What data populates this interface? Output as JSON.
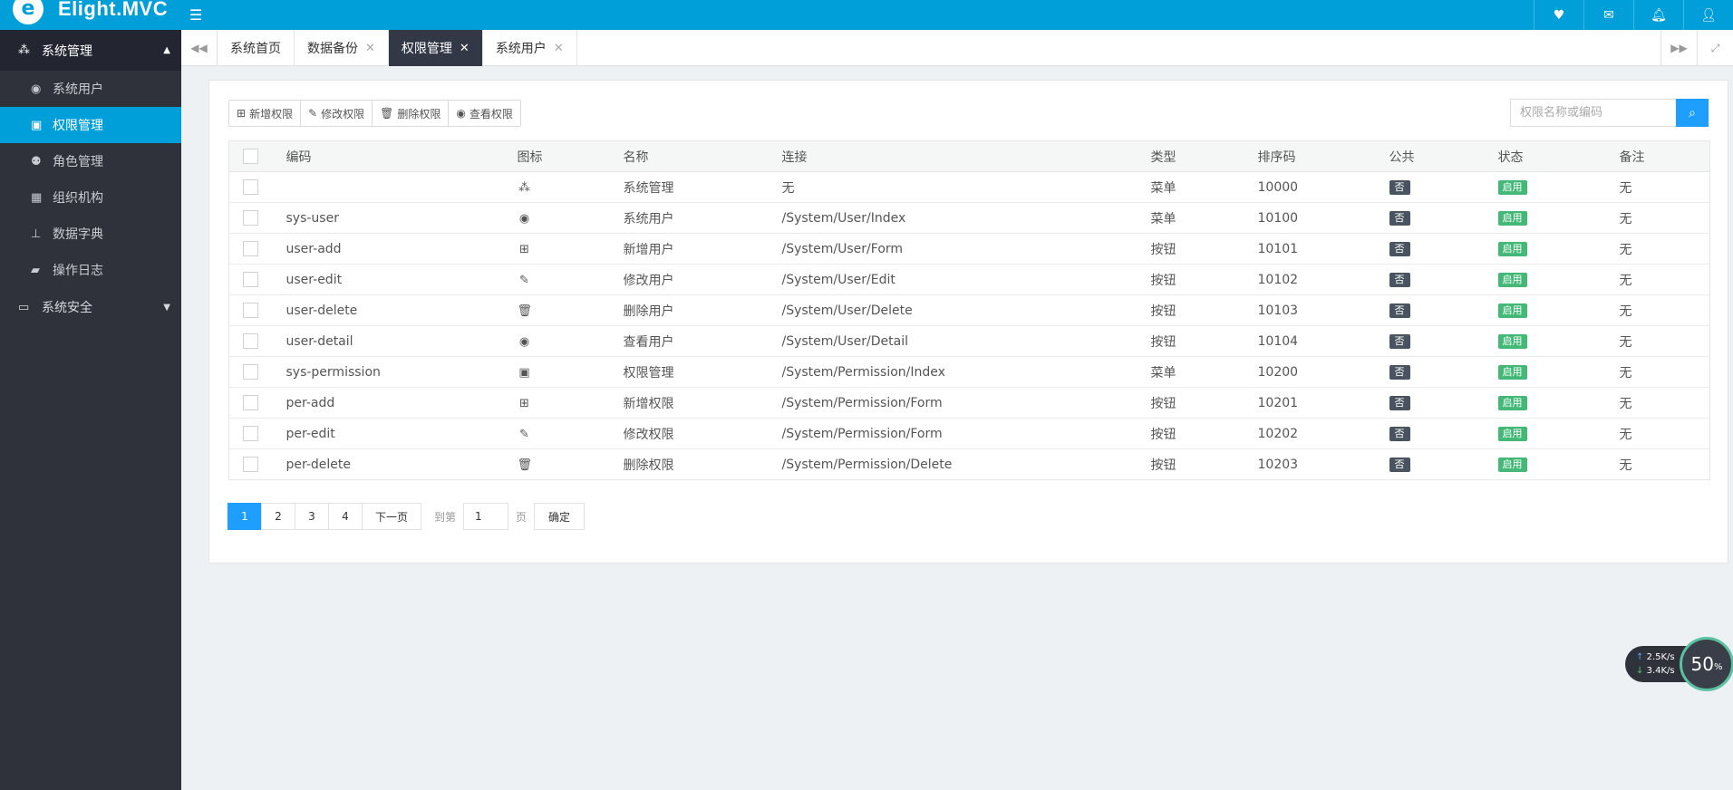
{
  "header": {
    "logo_mark": "e",
    "app_title": "Elight.MVC",
    "menu_icon": "list-icon",
    "icons": [
      "heart-icon",
      "mail-icon",
      "bell-icon",
      "user-icon"
    ]
  },
  "sidebar": {
    "group1": {
      "label": "系统管理",
      "icon": "cubes-icon"
    },
    "items": [
      {
        "label": "系统用户",
        "icon": "user-circle-icon",
        "active": false
      },
      {
        "label": "权限管理",
        "icon": "briefcase-icon",
        "active": true
      },
      {
        "label": "角色管理",
        "icon": "users-icon",
        "active": false
      },
      {
        "label": "组织机构",
        "icon": "building-icon",
        "active": false
      },
      {
        "label": "数据字典",
        "icon": "sitemap-icon",
        "active": false
      },
      {
        "label": "操作日志",
        "icon": "folder-open-icon",
        "active": false
      }
    ],
    "group2": {
      "label": "系统安全",
      "icon": "desktop-icon"
    }
  },
  "tabs": [
    {
      "label": "系统首页",
      "closable": false,
      "active": false
    },
    {
      "label": "数据备份",
      "closable": true,
      "active": false
    },
    {
      "label": "权限管理",
      "closable": true,
      "active": true
    },
    {
      "label": "系统用户",
      "closable": true,
      "active": false
    }
  ],
  "toolbar": {
    "add": "新增权限",
    "edit": "修改权限",
    "delete": "删除权限",
    "view": "查看权限"
  },
  "search": {
    "placeholder": "权限名称或编码"
  },
  "table": {
    "headers": [
      "编码",
      "图标",
      "名称",
      "连接",
      "类型",
      "排序码",
      "公共",
      "状态",
      "备注"
    ],
    "rows": [
      {
        "code": "",
        "icon": "cubes-icon",
        "name": "系统管理",
        "url": "无",
        "type": "菜单",
        "sort": "10000",
        "public": "否",
        "status": "启用",
        "remark": "无"
      },
      {
        "code": "sys-user",
        "icon": "user-circle-icon",
        "name": "系统用户",
        "url": "/System/User/Index",
        "type": "菜单",
        "sort": "10100",
        "public": "否",
        "status": "启用",
        "remark": "无"
      },
      {
        "code": "user-add",
        "icon": "plus-square-icon",
        "name": "新增用户",
        "url": "/System/User/Form",
        "type": "按钮",
        "sort": "10101",
        "public": "否",
        "status": "启用",
        "remark": "无"
      },
      {
        "code": "user-edit",
        "icon": "edit-icon",
        "name": "修改用户",
        "url": "/System/User/Edit",
        "type": "按钮",
        "sort": "10102",
        "public": "否",
        "status": "启用",
        "remark": "无"
      },
      {
        "code": "user-delete",
        "icon": "trash-icon",
        "name": "删除用户",
        "url": "/System/User/Delete",
        "type": "按钮",
        "sort": "10103",
        "public": "否",
        "status": "启用",
        "remark": "无"
      },
      {
        "code": "user-detail",
        "icon": "eye-icon",
        "name": "查看用户",
        "url": "/System/User/Detail",
        "type": "按钮",
        "sort": "10104",
        "public": "否",
        "status": "启用",
        "remark": "无"
      },
      {
        "code": "sys-permission",
        "icon": "briefcase-icon",
        "name": "权限管理",
        "url": "/System/Permission/Index",
        "type": "菜单",
        "sort": "10200",
        "public": "否",
        "status": "启用",
        "remark": "无"
      },
      {
        "code": "per-add",
        "icon": "plus-square-icon",
        "name": "新增权限",
        "url": "/System/Permission/Form",
        "type": "按钮",
        "sort": "10201",
        "public": "否",
        "status": "启用",
        "remark": "无"
      },
      {
        "code": "per-edit",
        "icon": "edit-icon",
        "name": "修改权限",
        "url": "/System/Permission/Form",
        "type": "按钮",
        "sort": "10202",
        "public": "否",
        "status": "启用",
        "remark": "无"
      },
      {
        "code": "per-delete",
        "icon": "trash-icon",
        "name": "删除权限",
        "url": "/System/Permission/Delete",
        "type": "按钮",
        "sort": "10203",
        "public": "否",
        "status": "启用",
        "remark": "无"
      }
    ]
  },
  "pager": {
    "pages": [
      "1",
      "2",
      "3",
      "4"
    ],
    "current": "1",
    "next": "下一页",
    "goto_label": "到第",
    "goto_value": "1",
    "page_suffix": "页",
    "confirm": "确定"
  },
  "net_widget": {
    "up": "2.5",
    "up_unit": "K/s",
    "down": "3.4",
    "down_unit": "K/s",
    "percent": "50",
    "percent_unit": "%"
  },
  "colors": {
    "header": "#009fd9",
    "sidebar": "#2f323b",
    "active_tab": "#333847",
    "primary_button": "#1e9fff",
    "badge_no": "#4a5460",
    "badge_on": "#43b877"
  }
}
